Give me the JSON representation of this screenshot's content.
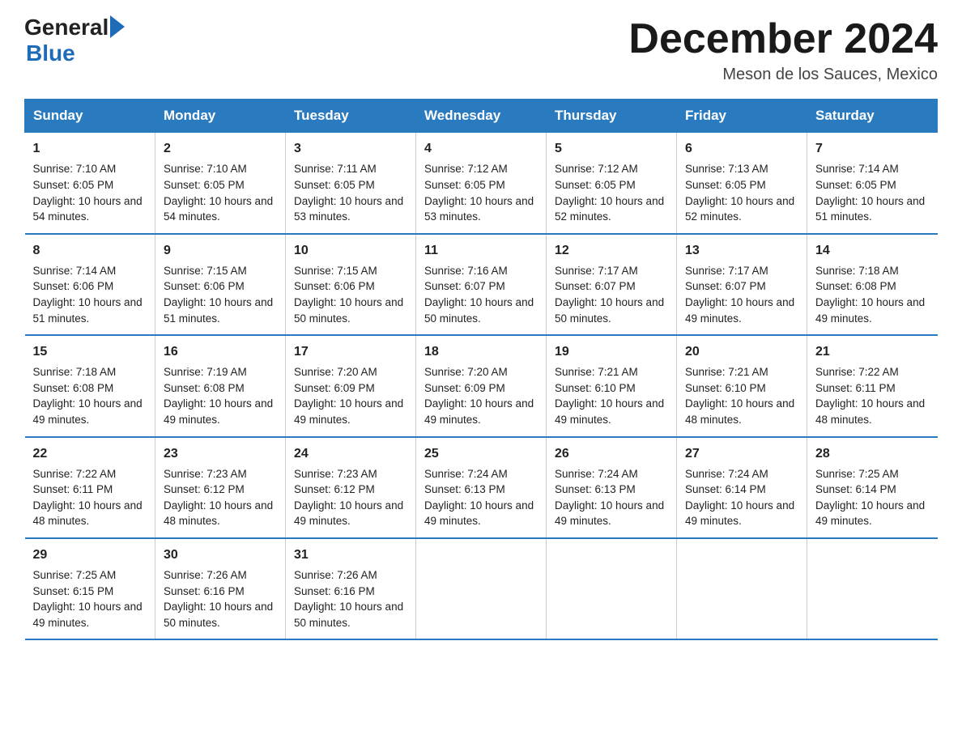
{
  "logo": {
    "general": "General",
    "blue": "Blue"
  },
  "title": "December 2024",
  "location": "Meson de los Sauces, Mexico",
  "days_of_week": [
    "Sunday",
    "Monday",
    "Tuesday",
    "Wednesday",
    "Thursday",
    "Friday",
    "Saturday"
  ],
  "weeks": [
    [
      {
        "day": "1",
        "sunrise": "7:10 AM",
        "sunset": "6:05 PM",
        "daylight": "10 hours and 54 minutes."
      },
      {
        "day": "2",
        "sunrise": "7:10 AM",
        "sunset": "6:05 PM",
        "daylight": "10 hours and 54 minutes."
      },
      {
        "day": "3",
        "sunrise": "7:11 AM",
        "sunset": "6:05 PM",
        "daylight": "10 hours and 53 minutes."
      },
      {
        "day": "4",
        "sunrise": "7:12 AM",
        "sunset": "6:05 PM",
        "daylight": "10 hours and 53 minutes."
      },
      {
        "day": "5",
        "sunrise": "7:12 AM",
        "sunset": "6:05 PM",
        "daylight": "10 hours and 52 minutes."
      },
      {
        "day": "6",
        "sunrise": "7:13 AM",
        "sunset": "6:05 PM",
        "daylight": "10 hours and 52 minutes."
      },
      {
        "day": "7",
        "sunrise": "7:14 AM",
        "sunset": "6:05 PM",
        "daylight": "10 hours and 51 minutes."
      }
    ],
    [
      {
        "day": "8",
        "sunrise": "7:14 AM",
        "sunset": "6:06 PM",
        "daylight": "10 hours and 51 minutes."
      },
      {
        "day": "9",
        "sunrise": "7:15 AM",
        "sunset": "6:06 PM",
        "daylight": "10 hours and 51 minutes."
      },
      {
        "day": "10",
        "sunrise": "7:15 AM",
        "sunset": "6:06 PM",
        "daylight": "10 hours and 50 minutes."
      },
      {
        "day": "11",
        "sunrise": "7:16 AM",
        "sunset": "6:07 PM",
        "daylight": "10 hours and 50 minutes."
      },
      {
        "day": "12",
        "sunrise": "7:17 AM",
        "sunset": "6:07 PM",
        "daylight": "10 hours and 50 minutes."
      },
      {
        "day": "13",
        "sunrise": "7:17 AM",
        "sunset": "6:07 PM",
        "daylight": "10 hours and 49 minutes."
      },
      {
        "day": "14",
        "sunrise": "7:18 AM",
        "sunset": "6:08 PM",
        "daylight": "10 hours and 49 minutes."
      }
    ],
    [
      {
        "day": "15",
        "sunrise": "7:18 AM",
        "sunset": "6:08 PM",
        "daylight": "10 hours and 49 minutes."
      },
      {
        "day": "16",
        "sunrise": "7:19 AM",
        "sunset": "6:08 PM",
        "daylight": "10 hours and 49 minutes."
      },
      {
        "day": "17",
        "sunrise": "7:20 AM",
        "sunset": "6:09 PM",
        "daylight": "10 hours and 49 minutes."
      },
      {
        "day": "18",
        "sunrise": "7:20 AM",
        "sunset": "6:09 PM",
        "daylight": "10 hours and 49 minutes."
      },
      {
        "day": "19",
        "sunrise": "7:21 AM",
        "sunset": "6:10 PM",
        "daylight": "10 hours and 49 minutes."
      },
      {
        "day": "20",
        "sunrise": "7:21 AM",
        "sunset": "6:10 PM",
        "daylight": "10 hours and 48 minutes."
      },
      {
        "day": "21",
        "sunrise": "7:22 AM",
        "sunset": "6:11 PM",
        "daylight": "10 hours and 48 minutes."
      }
    ],
    [
      {
        "day": "22",
        "sunrise": "7:22 AM",
        "sunset": "6:11 PM",
        "daylight": "10 hours and 48 minutes."
      },
      {
        "day": "23",
        "sunrise": "7:23 AM",
        "sunset": "6:12 PM",
        "daylight": "10 hours and 48 minutes."
      },
      {
        "day": "24",
        "sunrise": "7:23 AM",
        "sunset": "6:12 PM",
        "daylight": "10 hours and 49 minutes."
      },
      {
        "day": "25",
        "sunrise": "7:24 AM",
        "sunset": "6:13 PM",
        "daylight": "10 hours and 49 minutes."
      },
      {
        "day": "26",
        "sunrise": "7:24 AM",
        "sunset": "6:13 PM",
        "daylight": "10 hours and 49 minutes."
      },
      {
        "day": "27",
        "sunrise": "7:24 AM",
        "sunset": "6:14 PM",
        "daylight": "10 hours and 49 minutes."
      },
      {
        "day": "28",
        "sunrise": "7:25 AM",
        "sunset": "6:14 PM",
        "daylight": "10 hours and 49 minutes."
      }
    ],
    [
      {
        "day": "29",
        "sunrise": "7:25 AM",
        "sunset": "6:15 PM",
        "daylight": "10 hours and 49 minutes."
      },
      {
        "day": "30",
        "sunrise": "7:26 AM",
        "sunset": "6:16 PM",
        "daylight": "10 hours and 50 minutes."
      },
      {
        "day": "31",
        "sunrise": "7:26 AM",
        "sunset": "6:16 PM",
        "daylight": "10 hours and 50 minutes."
      },
      null,
      null,
      null,
      null
    ]
  ],
  "labels": {
    "sunrise": "Sunrise:",
    "sunset": "Sunset:",
    "daylight": "Daylight:"
  }
}
